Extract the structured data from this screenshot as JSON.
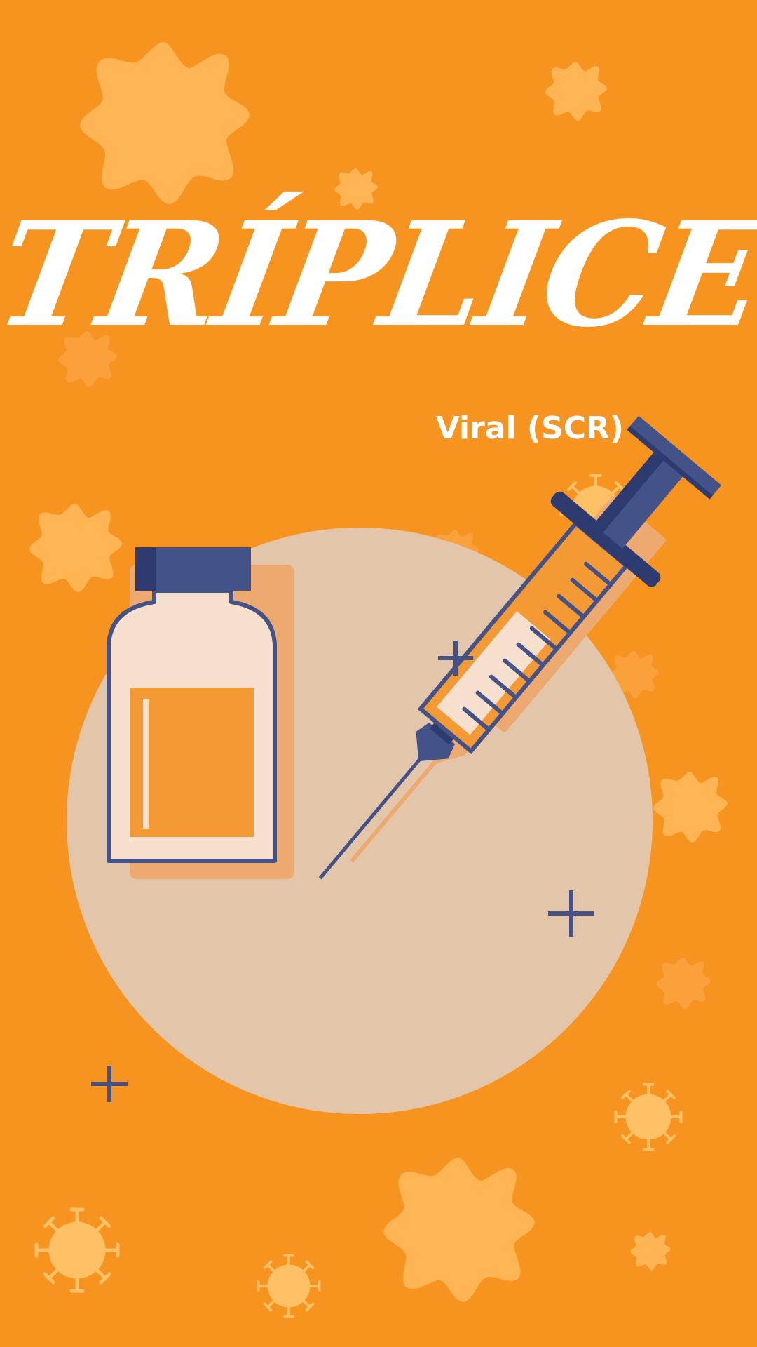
{
  "poster": {
    "title": "TRÍPLICE",
    "subtitle": "Viral (SCR)"
  },
  "colors": {
    "background": "#F79420",
    "virus_light": "#FFB554",
    "circle": "#E3C5AA",
    "navy": "#44528A",
    "vial_body": "#F8E0CF",
    "liquid": "#F49A35",
    "shadow": "#EDAA70"
  },
  "icons": [
    "virus-icon",
    "vaccine-vial-icon",
    "syringe-icon",
    "plus-icon"
  ]
}
